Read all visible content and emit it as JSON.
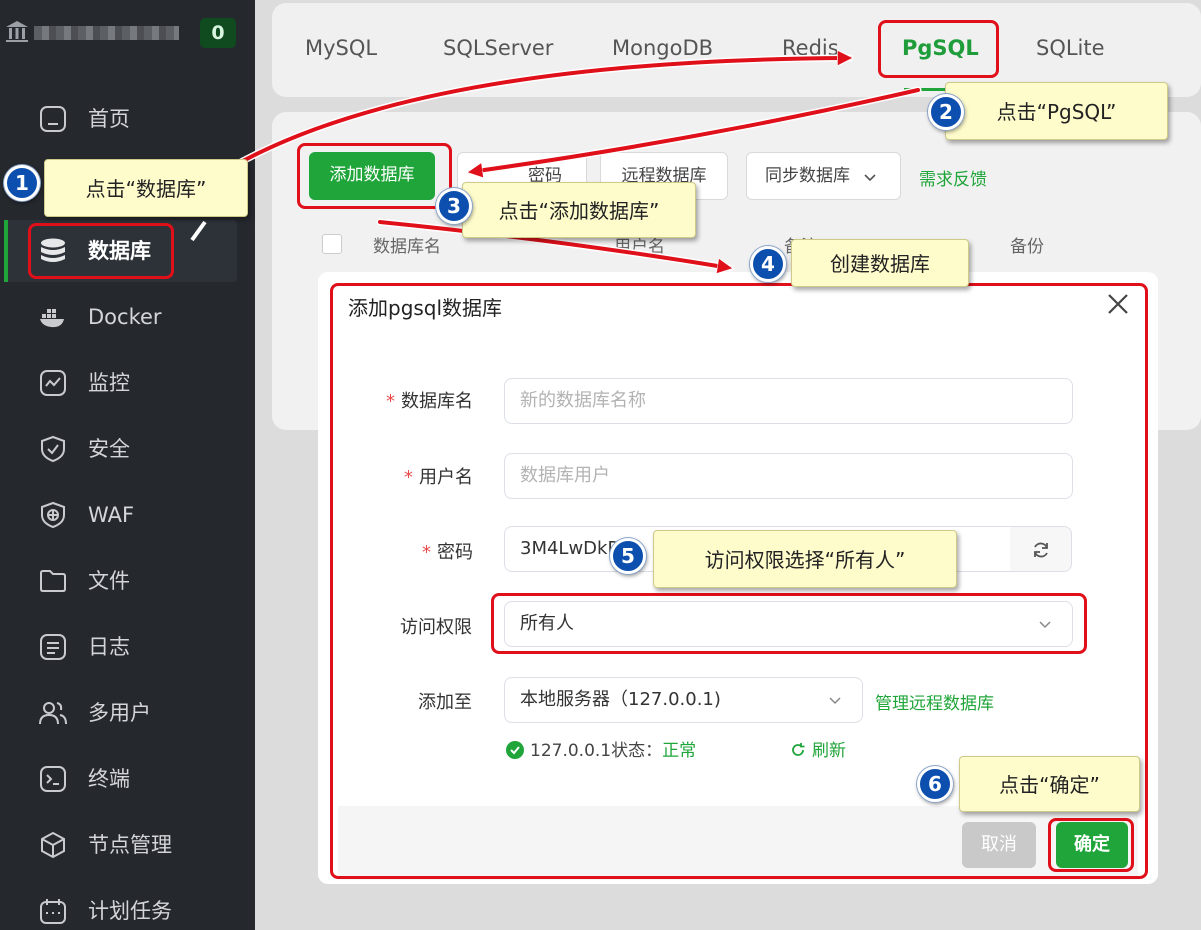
{
  "sidebar": {
    "badge": "0",
    "items": [
      {
        "label": "首页",
        "icon": "home-icon"
      },
      {
        "label": "数据库",
        "icon": "database-icon",
        "active": true
      },
      {
        "label": "Docker",
        "icon": "docker-icon"
      },
      {
        "label": "监控",
        "icon": "monitor-icon"
      },
      {
        "label": "安全",
        "icon": "shield-icon"
      },
      {
        "label": "WAF",
        "icon": "waf-icon"
      },
      {
        "label": "文件",
        "icon": "folder-icon"
      },
      {
        "label": "日志",
        "icon": "log-icon"
      },
      {
        "label": "多用户",
        "icon": "users-icon"
      },
      {
        "label": "终端",
        "icon": "terminal-icon"
      },
      {
        "label": "节点管理",
        "icon": "node-icon"
      },
      {
        "label": "计划任务",
        "icon": "calendar-icon"
      }
    ]
  },
  "db_tabs": [
    "MySQL",
    "SQLServer",
    "MongoDB",
    "Redis",
    "PgSQL",
    "SQLite"
  ],
  "active_tab": "PgSQL",
  "toolbar": {
    "add_db": "添加数据库",
    "root_password_partial": "密码",
    "remote_db": "远程数据库",
    "sync_db": "同步数据库",
    "feedback": "需求反馈"
  },
  "table": {
    "headers": [
      "数据库名",
      "用户名",
      "备注",
      "备份"
    ]
  },
  "dialog": {
    "title": "添加pgsql数据库",
    "fields": {
      "db_name": {
        "label": "数据库名",
        "placeholder": "新的数据库名称"
      },
      "username": {
        "label": "用户名",
        "placeholder": "数据库用户"
      },
      "password": {
        "label": "密码",
        "value": "3M4LwDkP"
      },
      "access": {
        "label": "访问权限",
        "value": "所有人"
      },
      "add_to": {
        "label": "添加至",
        "value": "本地服务器（127.0.0.1)"
      }
    },
    "manage_remote": "管理远程数据库",
    "status_prefix": "127.0.0.1状态：",
    "status_value": "正常",
    "refresh": "刷新",
    "cancel": "取消",
    "confirm": "确定"
  },
  "annotations": {
    "step1": {
      "num": "1",
      "text": "点击“数据库”"
    },
    "step2": {
      "num": "2",
      "text": "点击“PgSQL”"
    },
    "step3": {
      "num": "3",
      "text": "点击“添加数据库”"
    },
    "step4": {
      "num": "4",
      "text": "创建数据库"
    },
    "step5": {
      "num": "5",
      "text": "访问权限选择“所有人”"
    },
    "step6": {
      "num": "6",
      "text": "点击“确定”"
    }
  },
  "colors": {
    "accent": "#20a53a",
    "sidebar_bg": "#25292e",
    "highlight": "#e0101a",
    "step_badge": "#0c4fae",
    "tip_bg": "#fffccc"
  }
}
